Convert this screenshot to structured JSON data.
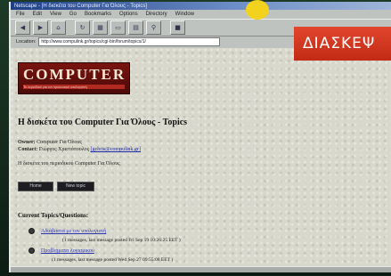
{
  "window": {
    "title": "Netscape - [Η δισκέτα του Computer Για Όλους - Topics]"
  },
  "menu": [
    "File",
    "Edit",
    "View",
    "Go",
    "Bookmarks",
    "Options",
    "Directory",
    "Window"
  ],
  "toolbar": {
    "buttons": [
      "back-icon",
      "forward-icon",
      "home-icon",
      "reload-icon",
      "images-icon",
      "open-icon",
      "print-icon",
      "find-icon",
      "stop-icon"
    ]
  },
  "location": {
    "label": "Location:",
    "url": "http://www.compulink.gr/topics/cgi-bin/forum/topics/1/"
  },
  "logo": {
    "text": "COMPUTER",
    "subtitle": "Το περιοδικό για τον προσωπικό υπολογιστή"
  },
  "page": {
    "title": "Η δισκέτα του Computer Για Όλους - Topics",
    "owner_label": "Owner:",
    "owner_value": "Computer Για Όλους",
    "contact_label": "Contact:",
    "contact_value": "Γιώργος Χριστόπουλος",
    "contact_email": "[gchris@compulink.gr]",
    "description": "Η δισκέτα του περιοδικού Computer Για Όλους",
    "button_1": "Home",
    "button_2": "New topic",
    "section_title": "Current Topics/Questions:"
  },
  "topics": [
    {
      "title": "Αδιάβαστα με τον υπολογιστή",
      "meta": "(1 messages, last message posted Fri Sep 19 10:26:25 EET )"
    },
    {
      "title": "Προβλήματα λογισμικού",
      "meta": "(1 messages, last message posted Wed Sep 27 09:55:08 EET )"
    }
  ],
  "overlay": {
    "banner_text": "ΔΙΑΣΚΕΨ"
  },
  "colors": {
    "banner": "#d63620",
    "logo_bg": "#6a1210",
    "link": "#2a34b0"
  }
}
